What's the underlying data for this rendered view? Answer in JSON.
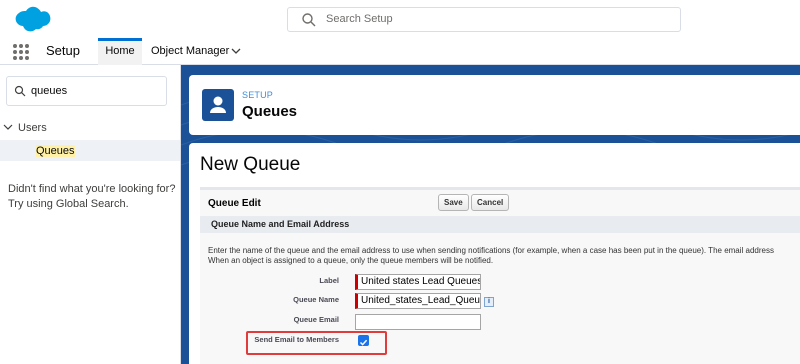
{
  "header": {
    "search_placeholder": "Search Setup"
  },
  "context_bar": {
    "app_name": "Setup",
    "tabs": [
      {
        "label": "Home"
      },
      {
        "label": "Object Manager"
      }
    ]
  },
  "sidebar": {
    "quick_find_value": "queues",
    "tree": {
      "parent": "Users",
      "child": "Queues"
    },
    "help_line1": "Didn't find what you're looking for?",
    "help_line2": "Try using Global Search."
  },
  "page_header": {
    "eyebrow": "SETUP",
    "title": "Queues"
  },
  "content": {
    "heading": "New Queue",
    "block_title": "Queue Edit",
    "save_label": "Save",
    "cancel_label": "Cancel",
    "section_title": "Queue Name and Email Address",
    "instructions_line1": "Enter the name of the queue and the email address to use when sending notifications (for example, when a case has been put in the queue). The email address",
    "instructions_line2": "When an object is assigned to a queue, only the queue members will be notified.",
    "fields": {
      "label": {
        "label": "Label",
        "value": "United states Lead Queues"
      },
      "queue_name": {
        "label": "Queue Name",
        "value": "United_states_Lead_Queue"
      },
      "queue_email": {
        "label": "Queue Email",
        "value": ""
      },
      "send_email": {
        "label": "Send Email to Members",
        "checked": true
      }
    },
    "info_icon_glyph": "i"
  },
  "colors": {
    "brand_blue": "#1b5297",
    "accent": "#0070d2",
    "highlight_border": "#e03c3c"
  }
}
